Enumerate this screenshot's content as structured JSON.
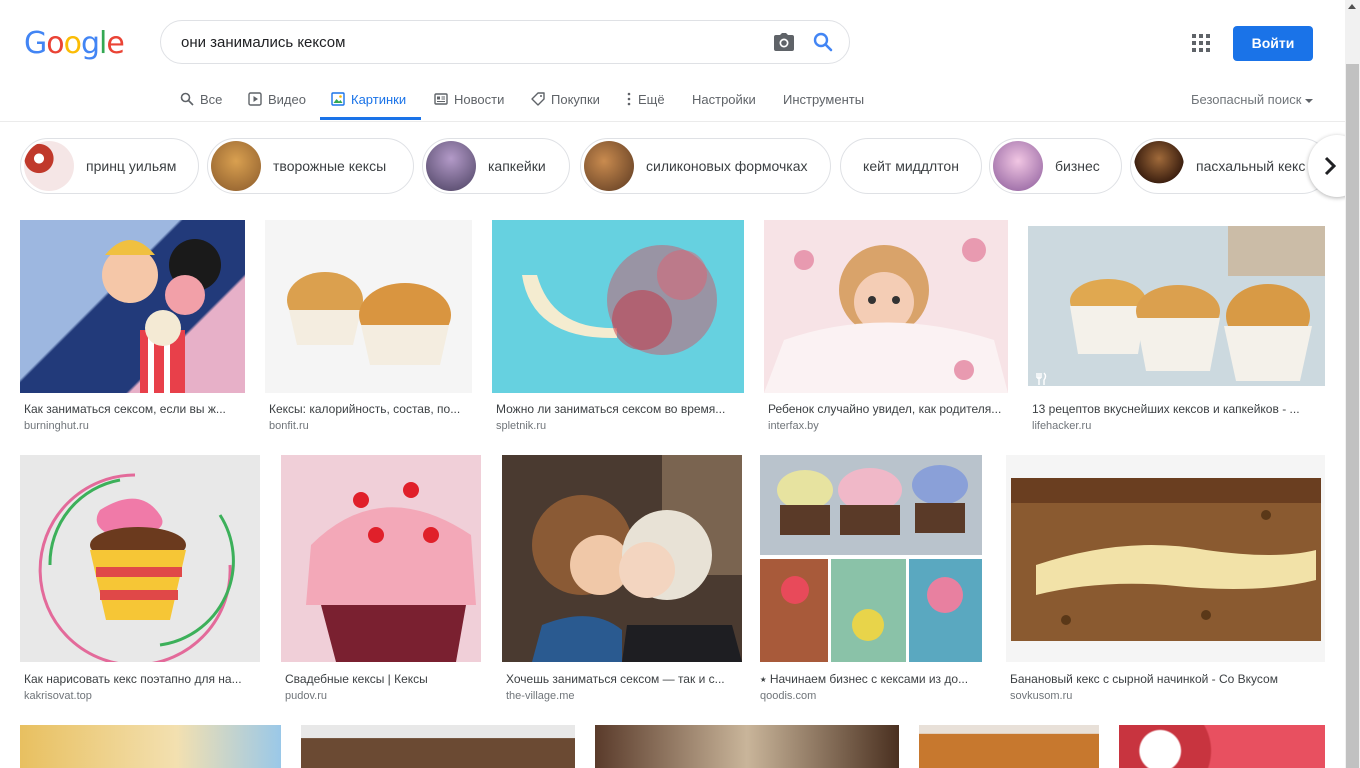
{
  "logo": {
    "g1": "G",
    "o1": "o",
    "o2": "o",
    "g2": "g",
    "l": "l",
    "e": "e"
  },
  "search": {
    "query": "они занимались кексом"
  },
  "header": {
    "signin_label": "Войти"
  },
  "tabs": [
    {
      "label": "Все",
      "icon": "search-icon"
    },
    {
      "label": "Видео",
      "icon": "video-icon"
    },
    {
      "label": "Картинки",
      "icon": "image-icon"
    },
    {
      "label": "Новости",
      "icon": "news-icon"
    },
    {
      "label": "Покупки",
      "icon": "tag-icon"
    },
    {
      "label": "Ещё",
      "icon": "more-vert-icon"
    },
    {
      "label": "Настройки"
    },
    {
      "label": "Инструменты"
    }
  ],
  "safe_search": {
    "label": "Безопасный поиск"
  },
  "chips": [
    {
      "label": "принц уильям",
      "color": "#c0392b"
    },
    {
      "label": "творожные кексы",
      "color": "#a0612a"
    },
    {
      "label": "капкейки",
      "color": "#6a5a7a"
    },
    {
      "label": "силиконовых формочках",
      "color": "#8b5a2b"
    },
    {
      "label": "кейт миддлтон"
    },
    {
      "label": "бизнес",
      "color": "#b07aa6"
    },
    {
      "label": "пасхальный кекс",
      "color": "#6b3a1e"
    }
  ],
  "results": [
    {
      "caption": "Как заниматься сексом, если вы ж...",
      "source": "burninghut.ru",
      "color": "#3e5fa8"
    },
    {
      "caption": "Кексы: калорийность, состав, по...",
      "source": "bonfit.ru",
      "color": "#d9a050"
    },
    {
      "caption": "Можно ли заниматься сексом во время...",
      "source": "spletnik.ru",
      "color": "#66d1e0"
    },
    {
      "caption": "Ребенок случайно увидел, как родителя...",
      "source": "interfax.by",
      "color": "#f3d4d8"
    },
    {
      "caption": "13 рецептов вкуснейших кексов и капкейков - ...",
      "source": "lifehacker.ru",
      "color": "#e0a850"
    },
    {
      "caption": "Как нарисовать кекс поэтапно для на...",
      "source": "kakrisovat.top",
      "color": "#e8e8e8"
    },
    {
      "caption": "Свадебные кексы | Кексы",
      "source": "pudov.ru",
      "color": "#e9a0b2"
    },
    {
      "caption": "Хочешь заниматься сексом — так и с...",
      "source": "the-village.me",
      "color": "#6b4d3a"
    },
    {
      "caption": "⭑ Начинаем бизнес с кексами из до...",
      "source": "qoodis.com",
      "color": "#8aa6c2"
    },
    {
      "caption": "Банановый кекс с сырной начинкой - Со Вкусом",
      "source": "sovkusom.ru",
      "color": "#8a5a30"
    },
    {
      "color": "#e8c060"
    },
    {
      "color": "#6b4a33"
    },
    {
      "color": "#5a3b2b"
    },
    {
      "color": "#c7782e"
    },
    {
      "color": "#c8343f"
    }
  ]
}
